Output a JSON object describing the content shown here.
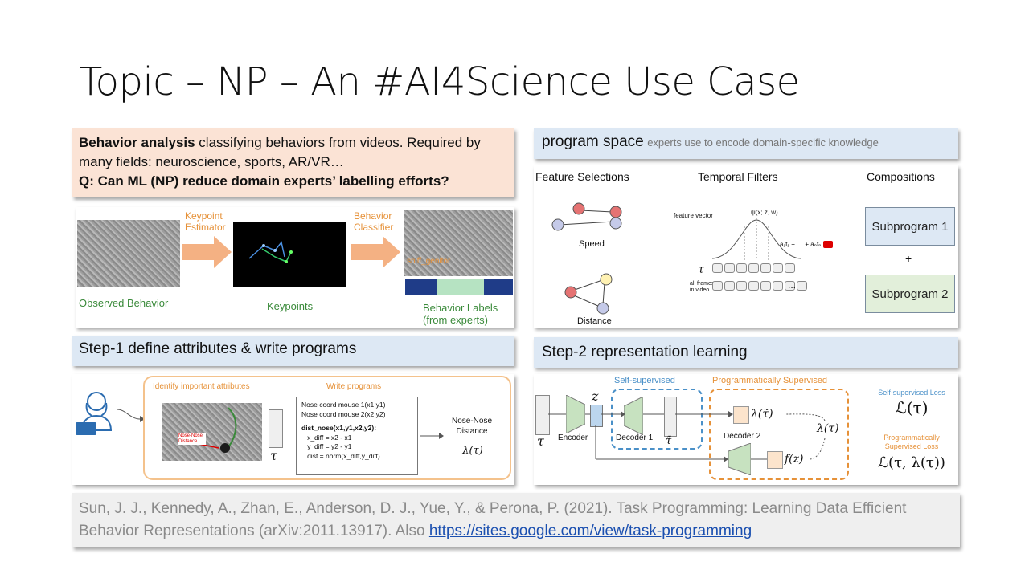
{
  "slide": {
    "title": "Topic – NP – An #AI4Science Use Case"
  },
  "intro": {
    "bold_lead": "Behavior analysis",
    "text1": " classifying behaviors from videos. Required by many fields: neuroscience, sports, AR/VR…",
    "question": "Q: Can ML (NP) reduce domain experts’ labelling efforts?"
  },
  "pipeline": {
    "keypoint_estimator": "Keypoint Estimator",
    "behavior_classifier": "Behavior Classifier",
    "observed_behavior": "Observed Behavior",
    "keypoints": "Keypoints",
    "behavior_labels": "Behavior Labels (from experts)",
    "sniff_label": "sniff_genitor"
  },
  "program_space": {
    "heading": "program space",
    "subheading": "experts use to encode domain-specific knowledge",
    "feature_selections": "Feature Selections",
    "temporal_filters": "Temporal Filters",
    "compositions": "Compositions",
    "speed": "Speed",
    "distance": "Distance",
    "feature_vector": "feature vector",
    "all_frames": "all frames in video",
    "psi": "ψ(x; z, w)",
    "sum_expr": "a₁f₁ + … + aₙfₙ =",
    "tau": "τ",
    "ellipsis": "...",
    "plus": "+",
    "subprogram1": "Subprogram 1",
    "subprogram2": "Subprogram 2"
  },
  "step1": {
    "heading": "Step-1 define attributes & write programs",
    "identify": "Identify important attributes",
    "write": "Write programs",
    "tau": "τ",
    "code": [
      "Nose coord mouse 1(x1,y1)",
      "Nose coord mouse 2(x2,y2)",
      "",
      "dist_nose(x1,y1,x2,y2):",
      "   x_diff = x2 - x1",
      "   y_diff = y2 - y1",
      "   dist = norm(x_diff,y_diff)"
    ],
    "nose_nose": "Nose-Nose Distance",
    "lambda": "λ(τ)",
    "nose_tag": "Nose-Nose Distance"
  },
  "step2": {
    "heading": "Step-2 representation learning",
    "self_supervised": "Self-supervised",
    "prog_supervised": "Programmatically Supervised",
    "encoder": "Encoder",
    "decoder1": "Decoder 1",
    "decoder2": "Decoder 2",
    "z": "z",
    "tau": "τ",
    "tau_tilde": "τ̃",
    "lambda_tilde": "λ(τ̃)",
    "lambda_tau": "λ(τ)",
    "f_z": "f(z)",
    "ss_loss_label": "Self-supervised Loss",
    "ss_loss": "ℒ(τ)",
    "ps_loss_label": "Programmatically Supervised Loss",
    "ps_loss": "ℒ(τ, λ(τ))"
  },
  "citation": {
    "text": "Sun, J. J., Kennedy, A., Zhan, E., Anderson, D. J., Yue, Y., & Perona, P. (2021). Task Programming: Learning Data Efficient Behavior Representations (arXiv:2011.13917).  Also ",
    "link": "https://sites.google.com/view/task-programming"
  },
  "colors": {
    "callout_bg": "#fbe3d5",
    "blue_box": "#dde8f4",
    "orange": "#e69138",
    "arrow_orange": "#f4b183",
    "navy": "#1f3c88",
    "green_label": "#3a8a3a",
    "self_sup_blue": "#4a90c8"
  }
}
